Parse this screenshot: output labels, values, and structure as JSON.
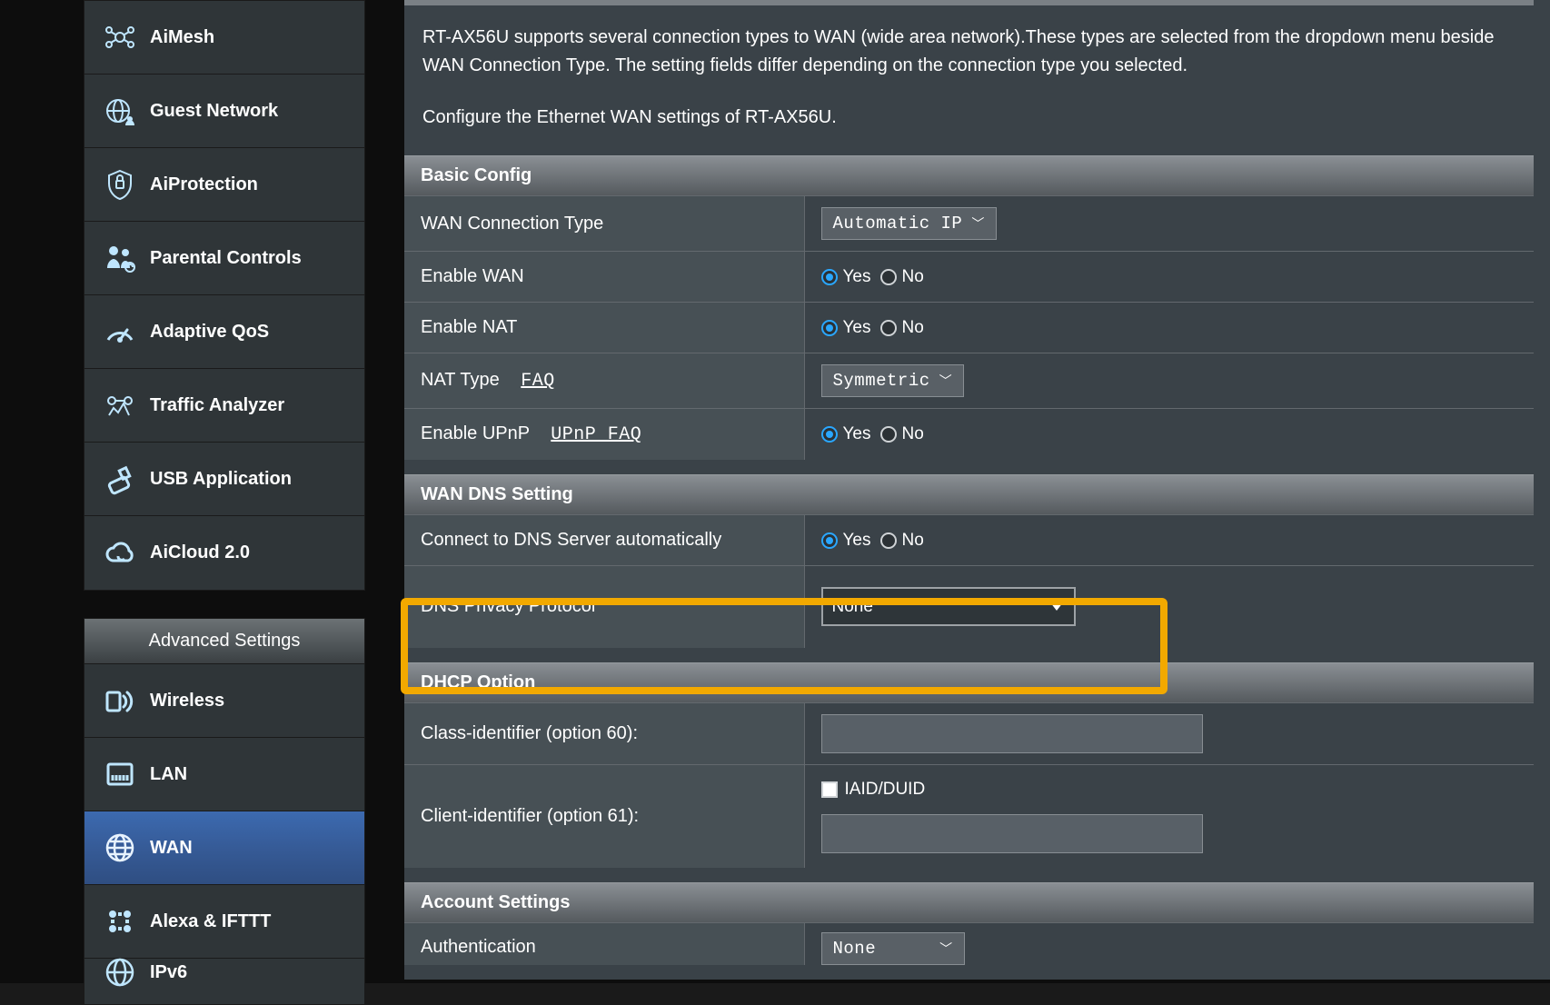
{
  "sidebar": {
    "items": [
      {
        "label": "AiMesh"
      },
      {
        "label": "Guest Network"
      },
      {
        "label": "AiProtection"
      },
      {
        "label": "Parental Controls"
      },
      {
        "label": "Adaptive QoS"
      },
      {
        "label": "Traffic Analyzer"
      },
      {
        "label": "USB Application"
      },
      {
        "label": "AiCloud 2.0"
      }
    ],
    "advanced_header": "Advanced Settings",
    "adv_items": [
      {
        "label": "Wireless"
      },
      {
        "label": "LAN"
      },
      {
        "label": "WAN"
      },
      {
        "label": "Alexa & IFTTT"
      },
      {
        "label": "IPv6"
      }
    ]
  },
  "intro": {
    "line1": "RT-AX56U supports several connection types to WAN (wide area network).These types are selected from the dropdown menu beside WAN Connection Type. The setting fields differ depending on the connection type you selected.",
    "line2": "Configure the Ethernet WAN settings of RT-AX56U."
  },
  "sections": {
    "basic": {
      "title": "Basic Config",
      "wan_conn_type_label": "WAN Connection Type",
      "wan_conn_type_value": "Automatic IP",
      "enable_wan_label": "Enable WAN",
      "enable_nat_label": "Enable NAT",
      "nat_type_label": "NAT Type",
      "nat_type_faq": "FAQ",
      "nat_type_value": "Symmetric",
      "enable_upnp_label": "Enable UPnP",
      "upnp_faq": "UPnP FAQ",
      "yes": "Yes",
      "no": "No"
    },
    "dns": {
      "title": "WAN DNS Setting",
      "connect_auto_label": "Connect to DNS Server automatically",
      "dns_privacy_label": "DNS Privacy Protocol",
      "dns_privacy_value": "None"
    },
    "dhcp": {
      "title": "DHCP Option",
      "class_id_label": "Class-identifier (option 60):",
      "client_id_label": "Client-identifier (option 61):",
      "iaid_label": "IAID/DUID"
    },
    "account": {
      "title": "Account Settings",
      "auth_label": "Authentication",
      "auth_value": "None"
    }
  }
}
